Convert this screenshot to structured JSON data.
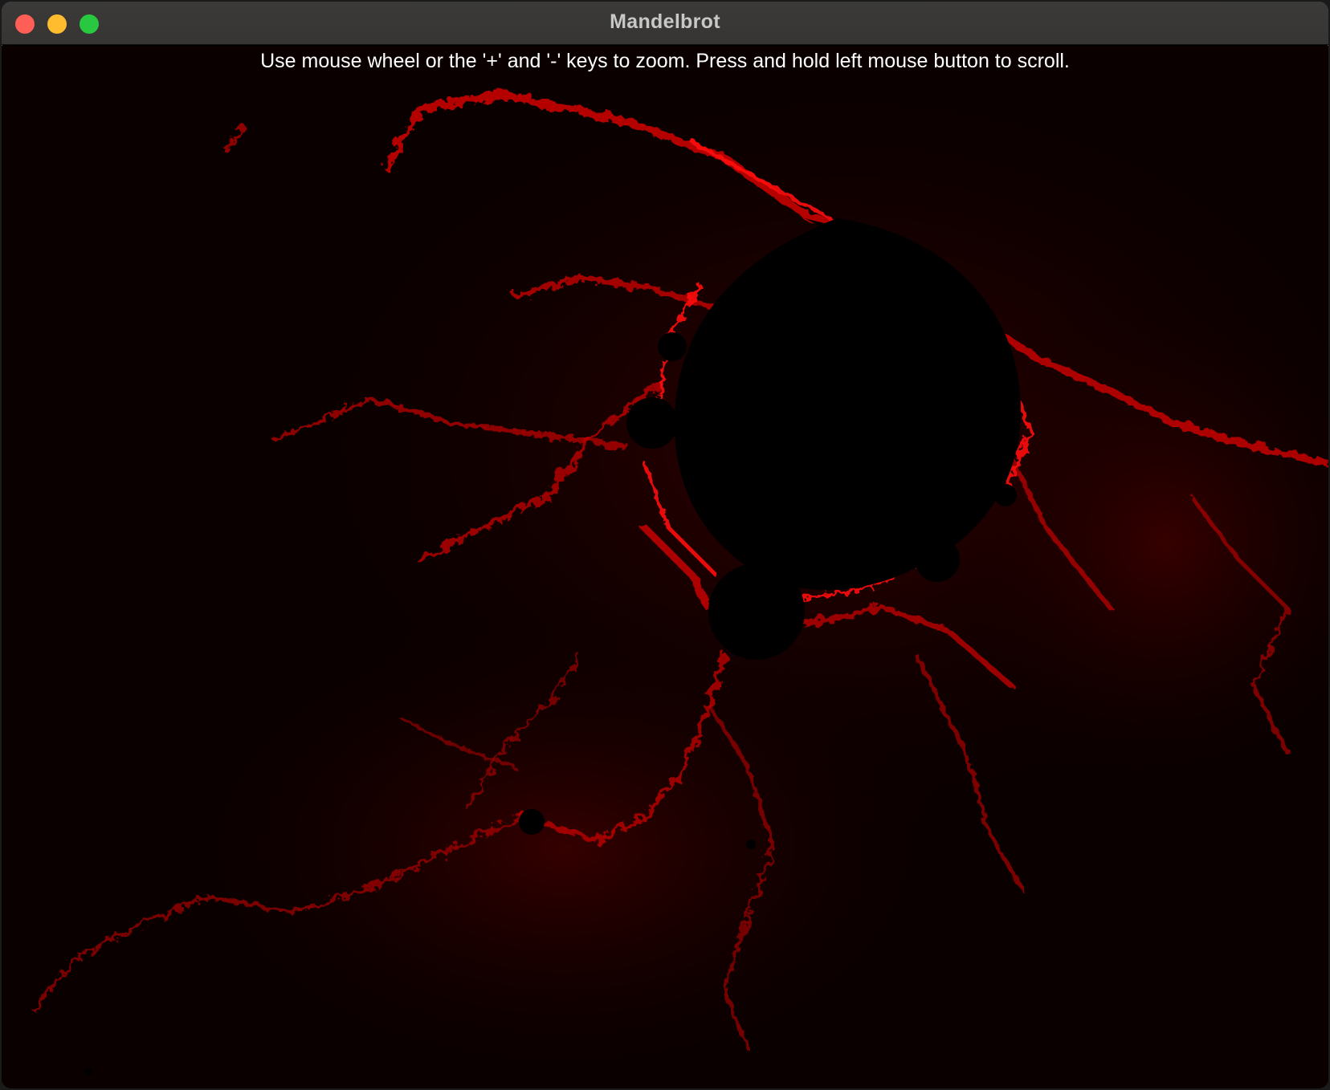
{
  "window": {
    "title": "Mandelbrot",
    "buttons": [
      "close",
      "minimize",
      "zoom"
    ]
  },
  "canvas": {
    "instructions": "Use mouse wheel or the '+' and '-' keys to zoom. Press and hold left mouse button to scroll.",
    "fractal": "mandelbrot-set",
    "colors": {
      "background": "#0a0000",
      "filament": "#e00000",
      "set_interior": "#000000"
    }
  }
}
